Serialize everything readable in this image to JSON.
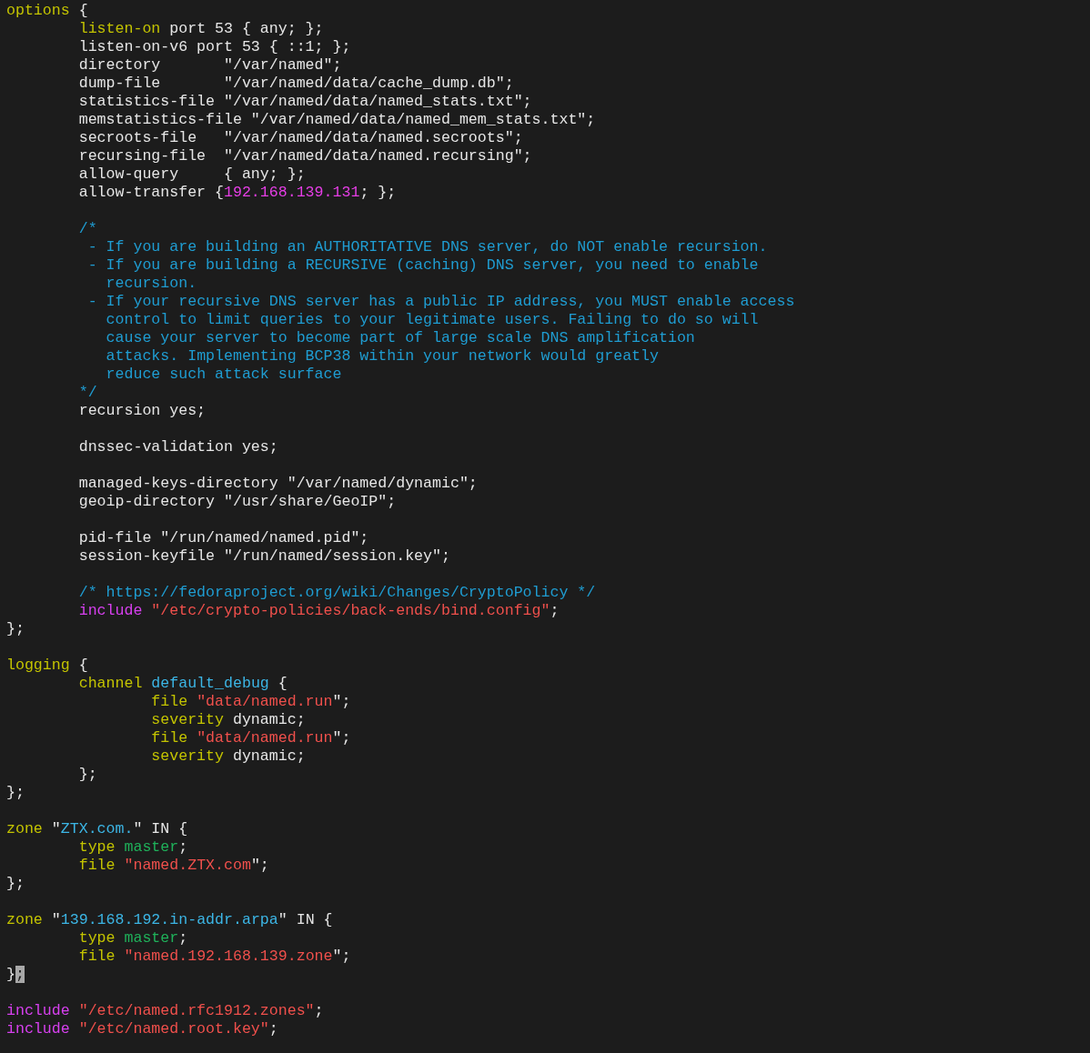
{
  "editor": {
    "lines": [
      {
        "kind": "code",
        "segments": [
          {
            "kind": "keyword",
            "text": "options"
          },
          {
            "kind": "plain",
            "text": " {"
          }
        ]
      },
      {
        "kind": "code",
        "segments": [
          {
            "kind": "keyword",
            "text": "\tlisten-on"
          },
          {
            "kind": "plain",
            "text": " port 53 { any; };"
          }
        ]
      },
      {
        "kind": "code",
        "segments": [
          {
            "kind": "plain",
            "text": "\tlisten-on-v6 port 53 { ::1; };"
          }
        ]
      },
      {
        "kind": "code",
        "segments": [
          {
            "kind": "plain",
            "text": "\tdirectory       \"/var/named\";"
          }
        ]
      },
      {
        "kind": "code",
        "segments": [
          {
            "kind": "plain",
            "text": "\tdump-file       \"/var/named/data/cache_dump.db\";"
          }
        ]
      },
      {
        "kind": "code",
        "segments": [
          {
            "kind": "plain",
            "text": "\tstatistics-file \"/var/named/data/named_stats.txt\";"
          }
        ]
      },
      {
        "kind": "code",
        "segments": [
          {
            "kind": "plain",
            "text": "\tmemstatistics-file \"/var/named/data/named_mem_stats.txt\";"
          }
        ]
      },
      {
        "kind": "code",
        "segments": [
          {
            "kind": "plain",
            "text": "\tsecroots-file   \"/var/named/data/named.secroots\";"
          }
        ]
      },
      {
        "kind": "code",
        "segments": [
          {
            "kind": "plain",
            "text": "\trecursing-file  \"/var/named/data/named.recursing\";"
          }
        ]
      },
      {
        "kind": "code",
        "segments": [
          {
            "kind": "plain",
            "text": "\tallow-query     { any; };"
          }
        ]
      },
      {
        "kind": "code",
        "segments": [
          {
            "kind": "plain",
            "text": "\tallow-transfer {"
          },
          {
            "kind": "number",
            "text": "192.168.139.131"
          },
          {
            "kind": "plain",
            "text": "; };"
          }
        ]
      },
      {
        "kind": "blank"
      },
      {
        "kind": "code",
        "segments": [
          {
            "kind": "comment",
            "text": "\t/*"
          }
        ]
      },
      {
        "kind": "code",
        "segments": [
          {
            "kind": "comment",
            "text": "\t - If you are building an AUTHORITATIVE DNS server, do NOT enable recursion."
          }
        ]
      },
      {
        "kind": "code",
        "segments": [
          {
            "kind": "comment",
            "text": "\t - If you are building a RECURSIVE (caching) DNS server, you need to enable"
          }
        ]
      },
      {
        "kind": "code",
        "segments": [
          {
            "kind": "comment",
            "text": "\t   recursion."
          }
        ]
      },
      {
        "kind": "code",
        "segments": [
          {
            "kind": "comment",
            "text": "\t - If your recursive DNS server has a public IP address, you MUST enable access"
          }
        ]
      },
      {
        "kind": "code",
        "segments": [
          {
            "kind": "comment",
            "text": "\t   control to limit queries to your legitimate users. Failing to do so will"
          }
        ]
      },
      {
        "kind": "code",
        "segments": [
          {
            "kind": "comment",
            "text": "\t   cause your server to become part of large scale DNS amplification"
          }
        ]
      },
      {
        "kind": "code",
        "segments": [
          {
            "kind": "comment",
            "text": "\t   attacks. Implementing BCP38 within your network would greatly"
          }
        ]
      },
      {
        "kind": "code",
        "segments": [
          {
            "kind": "comment",
            "text": "\t   reduce such attack surface"
          }
        ]
      },
      {
        "kind": "code",
        "segments": [
          {
            "kind": "comment",
            "text": "\t*/"
          }
        ]
      },
      {
        "kind": "code",
        "segments": [
          {
            "kind": "plain",
            "text": "\trecursion yes;"
          }
        ]
      },
      {
        "kind": "blank"
      },
      {
        "kind": "code",
        "segments": [
          {
            "kind": "plain",
            "text": "\tdnssec-validation yes;"
          }
        ]
      },
      {
        "kind": "blank"
      },
      {
        "kind": "code",
        "segments": [
          {
            "kind": "plain",
            "text": "\tmanaged-keys-directory \"/var/named/dynamic\";"
          }
        ]
      },
      {
        "kind": "code",
        "segments": [
          {
            "kind": "plain",
            "text": "\tgeoip-directory \"/usr/share/GeoIP\";"
          }
        ]
      },
      {
        "kind": "blank"
      },
      {
        "kind": "code",
        "segments": [
          {
            "kind": "plain",
            "text": "\tpid-file \"/run/named/named.pid\";"
          }
        ]
      },
      {
        "kind": "code",
        "segments": [
          {
            "kind": "plain",
            "text": "\tsession-keyfile \"/run/named/session.key\";"
          }
        ]
      },
      {
        "kind": "blank"
      },
      {
        "kind": "code",
        "segments": [
          {
            "kind": "comment",
            "text": "\t/* https://fedoraproject.org/wiki/Changes/CryptoPolicy */"
          }
        ]
      },
      {
        "kind": "code",
        "segments": [
          {
            "kind": "include",
            "text": "\tinclude "
          },
          {
            "kind": "string",
            "text": "\"/etc/crypto-policies/back-ends/bind.config\""
          },
          {
            "kind": "plain",
            "text": ";"
          }
        ]
      },
      {
        "kind": "code",
        "segments": [
          {
            "kind": "plain",
            "text": "};"
          }
        ]
      },
      {
        "kind": "blank"
      },
      {
        "kind": "code",
        "segments": [
          {
            "kind": "keyword",
            "text": "logging"
          },
          {
            "kind": "plain",
            "text": " {"
          }
        ]
      },
      {
        "kind": "code",
        "segments": [
          {
            "kind": "keyword",
            "text": "\tchannel "
          },
          {
            "kind": "name",
            "text": "default_debug"
          },
          {
            "kind": "plain",
            "text": " {"
          }
        ]
      },
      {
        "kind": "code",
        "segments": [
          {
            "kind": "keyword",
            "text": "\t\tfile "
          },
          {
            "kind": "string",
            "text": "\"data/named.run"
          },
          {
            "kind": "plain",
            "text": "\";"
          }
        ]
      },
      {
        "kind": "code",
        "segments": [
          {
            "kind": "keyword",
            "text": "\t\tseverity"
          },
          {
            "kind": "plain",
            "text": " dynamic;"
          }
        ]
      },
      {
        "kind": "code",
        "segments": [
          {
            "kind": "keyword",
            "text": "\t\tfile "
          },
          {
            "kind": "string",
            "text": "\"data/named.run"
          },
          {
            "kind": "plain",
            "text": "\";"
          }
        ]
      },
      {
        "kind": "code",
        "segments": [
          {
            "kind": "keyword",
            "text": "\t\tseverity"
          },
          {
            "kind": "plain",
            "text": " dynamic;"
          }
        ]
      },
      {
        "kind": "code",
        "segments": [
          {
            "kind": "plain",
            "text": "\t};"
          }
        ]
      },
      {
        "kind": "code",
        "segments": [
          {
            "kind": "plain",
            "text": "};"
          }
        ]
      },
      {
        "kind": "blank"
      },
      {
        "kind": "code",
        "segments": [
          {
            "kind": "keyword",
            "text": "zone"
          },
          {
            "kind": "plain",
            "text": " \""
          },
          {
            "kind": "name",
            "text": "ZTX.com."
          },
          {
            "kind": "plain",
            "text": "\" IN {"
          }
        ]
      },
      {
        "kind": "code",
        "segments": [
          {
            "kind": "keyword",
            "text": "\ttype "
          },
          {
            "kind": "value",
            "text": "master"
          },
          {
            "kind": "plain",
            "text": ";"
          }
        ]
      },
      {
        "kind": "code",
        "segments": [
          {
            "kind": "keyword",
            "text": "\tfile "
          },
          {
            "kind": "string",
            "text": "\"named.ZTX.com"
          },
          {
            "kind": "plain",
            "text": "\";"
          }
        ]
      },
      {
        "kind": "code",
        "segments": [
          {
            "kind": "plain",
            "text": "};"
          }
        ]
      },
      {
        "kind": "blank"
      },
      {
        "kind": "code",
        "segments": [
          {
            "kind": "keyword",
            "text": "zone"
          },
          {
            "kind": "plain",
            "text": " \""
          },
          {
            "kind": "name",
            "text": "139.168.192.in-addr.arpa"
          },
          {
            "kind": "plain",
            "text": "\" IN {"
          }
        ]
      },
      {
        "kind": "code",
        "segments": [
          {
            "kind": "keyword",
            "text": "\ttype "
          },
          {
            "kind": "value",
            "text": "master"
          },
          {
            "kind": "plain",
            "text": ";"
          }
        ]
      },
      {
        "kind": "code",
        "segments": [
          {
            "kind": "keyword",
            "text": "\tfile "
          },
          {
            "kind": "string",
            "text": "\"named.192.168.139.zone"
          },
          {
            "kind": "plain",
            "text": "\";"
          }
        ]
      },
      {
        "kind": "code",
        "segments": [
          {
            "kind": "plain",
            "text": "}"
          },
          {
            "kind": "cursor",
            "text": ";"
          }
        ]
      },
      {
        "kind": "blank"
      },
      {
        "kind": "code",
        "segments": [
          {
            "kind": "include",
            "text": "include "
          },
          {
            "kind": "string",
            "text": "\"/etc/named.rfc1912.zones\""
          },
          {
            "kind": "plain",
            "text": ";"
          }
        ]
      },
      {
        "kind": "code",
        "segments": [
          {
            "kind": "include",
            "text": "include "
          },
          {
            "kind": "string",
            "text": "\"/etc/named.root.key\""
          },
          {
            "kind": "plain",
            "text": ";"
          }
        ]
      }
    ]
  }
}
